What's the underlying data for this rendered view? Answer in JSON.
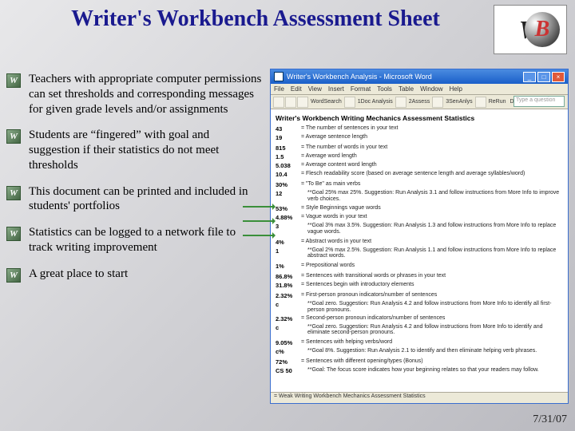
{
  "title": "Writer's Workbench Assessment Sheet",
  "bullets": [
    "Teachers with appropriate computer permissions can set thresholds and corresponding messages for given grade levels and/or assignments",
    "Students are “fingered” with goal and suggestion if their statistics do not meet thresholds",
    "This document can be printed and included in students' portfolios",
    "Statistics can be logged to a network file to track writing improvement",
    "A great place to start"
  ],
  "footer_date": "7/31/07",
  "word_window": {
    "title": "Writer's Workbench Analysis - Microsoft Word",
    "menus": [
      "File",
      "Edit",
      "View",
      "Insert",
      "Format",
      "Tools",
      "Table",
      "Window",
      "Help"
    ],
    "toolbar_labels": [
      "WordSearch",
      "1Doc Analysis",
      "2Assess",
      "3SenAnlys",
      "ReRun",
      "Doc Analysis"
    ],
    "assist_placeholder": "Type a question",
    "doc_heading": "Writer's Workbench Writing Mechanics Assessment Statistics",
    "stats": [
      {
        "n": "43",
        "t": "= The number of sentences in your text"
      },
      {
        "n": "19",
        "t": "= Average sentence length"
      },
      {
        "n": "",
        "t": ""
      },
      {
        "n": "815",
        "t": "= The number of words in your text"
      },
      {
        "n": "1.5",
        "t": "= Average word length"
      },
      {
        "n": "5.038",
        "t": "= Average content word length"
      },
      {
        "n": "10.4",
        "t": "= Flesch readability score (based on average sentence length and average syllables/word)"
      },
      {
        "n": "",
        "t": ""
      },
      {
        "n": "30%",
        "t": "= \"To Be\" as main verbs"
      },
      {
        "n": "12",
        "t": "**Goal 25% max 25%. Suggestion: Run Analysis 3.1 and follow instructions from More Info to improve verb choices."
      },
      {
        "n": "",
        "t": ""
      },
      {
        "n": "53%",
        "t": "= Style Beginnings vague words"
      },
      {
        "n": "4.88%",
        "t": "= Vague words in your text"
      },
      {
        "n": "3",
        "t": "**Goal 3% max 3.5%. Suggestion: Run Analysis 1.3 and follow instructions from More Info to replace vague words."
      },
      {
        "n": "",
        "t": ""
      },
      {
        "n": "4%",
        "t": "= Abstract words in your text"
      },
      {
        "n": "1",
        "t": "**Goal 2% max 2.5%. Suggestion: Run Analysis 1.1 and follow instructions from More Info to replace abstract words."
      },
      {
        "n": "",
        "t": ""
      },
      {
        "n": "1%",
        "t": "= Prepositional words"
      },
      {
        "n": "",
        "t": ""
      },
      {
        "n": "86.8%",
        "t": "= Sentences with transitional words or phrases in your text"
      },
      {
        "n": "31.8%",
        "t": "= Sentences begin with introductory elements"
      },
      {
        "n": "",
        "t": ""
      },
      {
        "n": "2.32%",
        "t": "= First-person pronoun indicators/number of sentences"
      },
      {
        "n": "c",
        "t": "**Goal zero. Suggestion: Run Analysis 4.2 and follow instructions from More Info to identify all first-person pronouns."
      },
      {
        "n": "2.32%",
        "t": "= Second-person pronoun indicators/number of sentences"
      },
      {
        "n": "c",
        "t": "**Goal zero. Suggestion: Run Analysis 4.2 and follow instructions from More Info to identify and eliminate second-person pronouns."
      },
      {
        "n": "",
        "t": ""
      },
      {
        "n": "9.05%",
        "t": "= Sentences with helping verbs/word"
      },
      {
        "n": "c%",
        "t": "**Goal 8%. Suggestion: Run Analysis 2.1 to identify and then eliminate helping verb phrases."
      },
      {
        "n": "",
        "t": ""
      },
      {
        "n": "72%",
        "t": "= Sentences with different opening/types (Bonus)"
      },
      {
        "n": "CS 50",
        "t": "**Goal: The focus score indicates how your beginning relates so that your readers may follow."
      }
    ],
    "status": "= Weak Writing Workbench Mechanics Assessment Statistics"
  }
}
